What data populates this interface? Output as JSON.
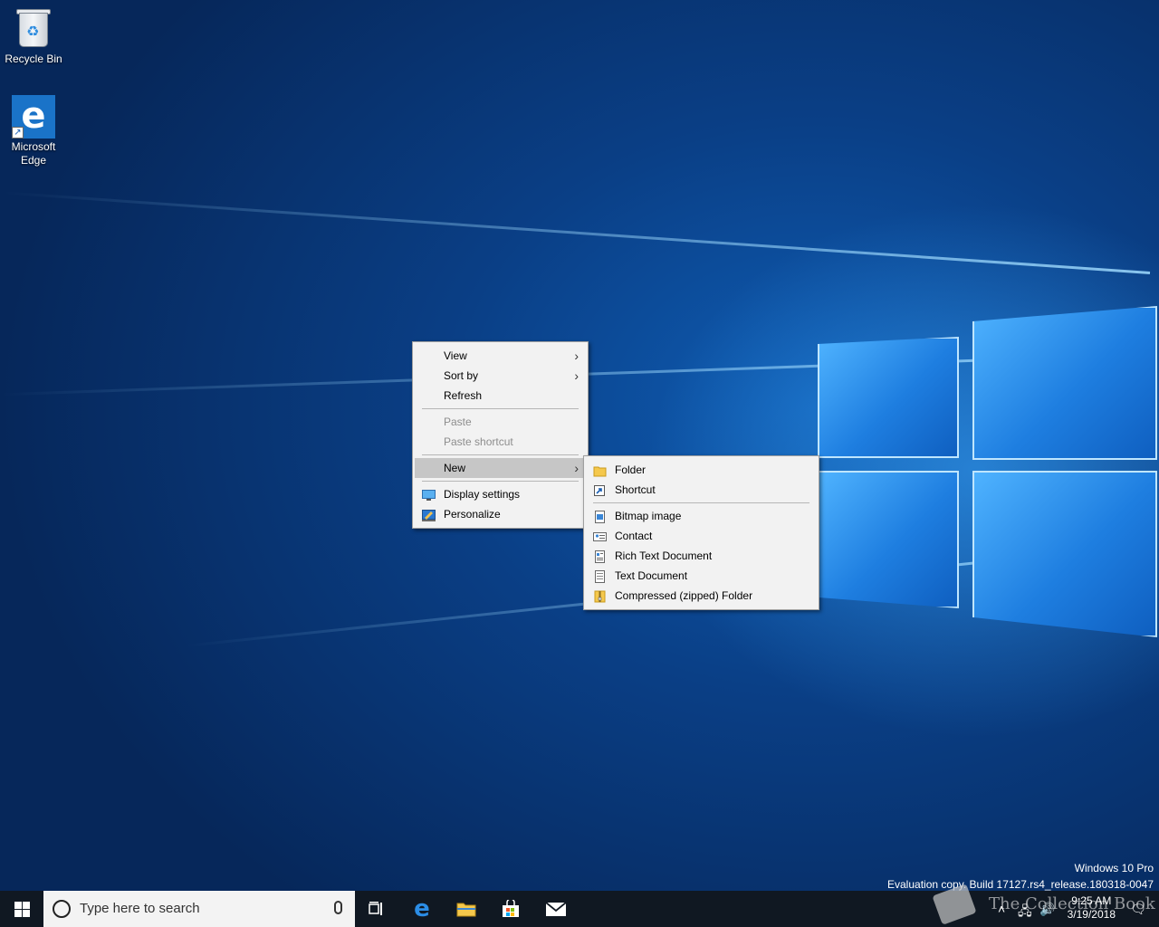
{
  "desktop": {
    "icons": [
      {
        "label": "Recycle Bin"
      },
      {
        "label": "Microsoft Edge"
      }
    ]
  },
  "context_menu": {
    "items": [
      {
        "label": "View"
      },
      {
        "label": "Sort by"
      },
      {
        "label": "Refresh"
      },
      {
        "label": "Paste"
      },
      {
        "label": "Paste shortcut"
      },
      {
        "label": "New"
      },
      {
        "label": "Display settings"
      },
      {
        "label": "Personalize"
      }
    ]
  },
  "new_submenu": {
    "items": [
      {
        "label": "Folder"
      },
      {
        "label": "Shortcut"
      },
      {
        "label": "Bitmap image"
      },
      {
        "label": "Contact"
      },
      {
        "label": "Rich Text Document"
      },
      {
        "label": "Text Document"
      },
      {
        "label": "Compressed (zipped) Folder"
      }
    ]
  },
  "watermark": {
    "edition": "Windows 10 Pro",
    "build": "Evaluation copy. Build 17127.rs4_release.180318-0047"
  },
  "taskbar": {
    "search_placeholder": "Type here to search",
    "time": "9:25 AM",
    "date": "3/19/2018"
  },
  "brand_overlay": {
    "text": "The Collection Book"
  },
  "colors": {
    "menu_bg": "#f2f2f2",
    "menu_hover": "#c6c6c6",
    "taskbar_bg": "#101822",
    "desktop_blue": "#0a3f86"
  }
}
